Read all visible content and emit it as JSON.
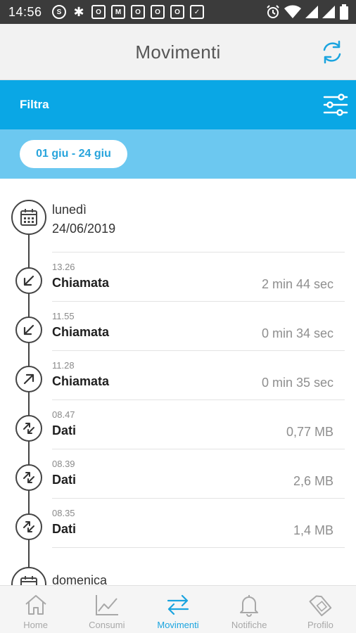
{
  "status_bar": {
    "time": "14:56",
    "left_icons": [
      "skype-icon",
      "slack-icon",
      "outlook-icon",
      "gmail-icon",
      "outlook-icon",
      "outlook-icon",
      "outlook-icon",
      "check-icon"
    ],
    "right_icons": [
      "alarm-icon",
      "wifi-icon",
      "signal-icon",
      "signal-icon",
      "battery-icon"
    ]
  },
  "header": {
    "title": "Movimenti"
  },
  "filter": {
    "label": "Filtra"
  },
  "date_range": {
    "label": "01 giu - 24 giu"
  },
  "colors": {
    "accent": "#0aa7e5",
    "accent_light": "#6cc8f0",
    "nav_active": "#1aa4df"
  },
  "days": [
    {
      "name": "lunedì",
      "date": "24/06/2019",
      "entries": [
        {
          "time": "13.26",
          "type": "Chiamata",
          "value": "2 min 44 sec",
          "icon": "incoming-call-icon"
        },
        {
          "time": "11.55",
          "type": "Chiamata",
          "value": "0 min 34 sec",
          "icon": "incoming-call-icon"
        },
        {
          "time": "11.28",
          "type": "Chiamata",
          "value": "0 min 35 sec",
          "icon": "outgoing-call-icon"
        },
        {
          "time": "08.47",
          "type": "Dati",
          "value": "0,77 MB",
          "icon": "data-transfer-icon"
        },
        {
          "time": "08.39",
          "type": "Dati",
          "value": "2,6 MB",
          "icon": "data-transfer-icon"
        },
        {
          "time": "08.35",
          "type": "Dati",
          "value": "1,4 MB",
          "icon": "data-transfer-icon"
        }
      ]
    },
    {
      "name": "domenica"
    }
  ],
  "nav": {
    "items": [
      {
        "label": "Home",
        "icon": "home-icon"
      },
      {
        "label": "Consumi",
        "icon": "chart-icon"
      },
      {
        "label": "Movimenti",
        "icon": "transfer-arrows-icon",
        "active": true
      },
      {
        "label": "Notifiche",
        "icon": "bell-icon"
      },
      {
        "label": "Profilo",
        "icon": "sim-card-icon"
      }
    ]
  }
}
